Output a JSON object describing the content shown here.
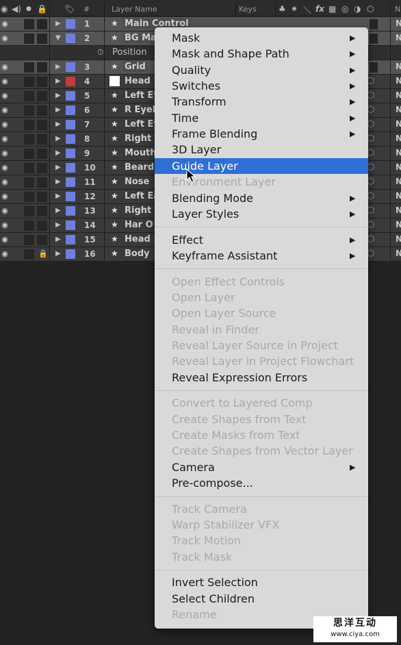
{
  "timeline": {
    "header": {
      "hash": "#",
      "layer_name": "Layer Name",
      "keys": "Keys",
      "fx": "fx",
      "mode_col": "N"
    },
    "layers": [
      {
        "num": "1",
        "name": "Main Control",
        "color": "#6f7fe0",
        "expanded": false,
        "selected": true,
        "boxed": true
      },
      {
        "num": "2",
        "name": "BG Ma",
        "color": "#6f7fe0",
        "expanded": true,
        "selected": true,
        "boxed": true
      },
      {
        "property": "Position"
      },
      {
        "num": "3",
        "name": "Grid",
        "color": "#6f7fe0",
        "expanded": false,
        "selected": true,
        "boxed": true
      },
      {
        "num": "4",
        "name": "Head",
        "color": "#c83a3a",
        "swatch": true
      },
      {
        "num": "5",
        "name": "Left Ey",
        "color": "#6f7fe0"
      },
      {
        "num": "6",
        "name": "R Eyeb",
        "color": "#6f7fe0"
      },
      {
        "num": "7",
        "name": "Left Ey",
        "color": "#6f7fe0"
      },
      {
        "num": "8",
        "name": "Right",
        "color": "#6f7fe0"
      },
      {
        "num": "9",
        "name": "Mouth",
        "color": "#6f7fe0"
      },
      {
        "num": "10",
        "name": "Beard",
        "color": "#6f7fe0"
      },
      {
        "num": "11",
        "name": "Nose",
        "color": "#6f7fe0"
      },
      {
        "num": "12",
        "name": "Left Ea",
        "color": "#6f7fe0"
      },
      {
        "num": "13",
        "name": "Right",
        "color": "#6f7fe0"
      },
      {
        "num": "14",
        "name": "Har O",
        "color": "#6f7fe0"
      },
      {
        "num": "15",
        "name": "Head",
        "color": "#6f7fe0"
      },
      {
        "num": "16",
        "name": "Body",
        "color": "#6f7fe0",
        "locked": true
      }
    ]
  },
  "context_menu": {
    "highlight_color": "#2f6fd6",
    "items": [
      {
        "label": "Mask",
        "submenu": true
      },
      {
        "label": "Mask and Shape Path",
        "submenu": true
      },
      {
        "label": "Quality",
        "submenu": true
      },
      {
        "label": "Switches",
        "submenu": true
      },
      {
        "label": "Transform",
        "submenu": true
      },
      {
        "label": "Time",
        "submenu": true
      },
      {
        "label": "Frame Blending",
        "submenu": true
      },
      {
        "label": "3D Layer"
      },
      {
        "label": "Guide Layer",
        "highlighted": true
      },
      {
        "label": "Environment Layer",
        "disabled": true
      },
      {
        "label": "Blending Mode",
        "submenu": true
      },
      {
        "label": "Layer Styles",
        "submenu": true
      },
      {
        "separator": true
      },
      {
        "label": "Effect",
        "submenu": true
      },
      {
        "label": "Keyframe Assistant",
        "submenu": true
      },
      {
        "separator": true
      },
      {
        "label": "Open Effect Controls",
        "disabled": true
      },
      {
        "label": "Open Layer",
        "disabled": true
      },
      {
        "label": "Open Layer Source",
        "disabled": true
      },
      {
        "label": "Reveal in Finder",
        "disabled": true
      },
      {
        "label": "Reveal Layer Source in Project",
        "disabled": true
      },
      {
        "label": "Reveal Layer in Project Flowchart",
        "disabled": true
      },
      {
        "label": "Reveal Expression Errors"
      },
      {
        "separator": true
      },
      {
        "label": "Convert to Layered Comp",
        "disabled": true
      },
      {
        "label": "Create Shapes from Text",
        "disabled": true
      },
      {
        "label": "Create Masks from Text",
        "disabled": true
      },
      {
        "label": "Create Shapes from Vector Layer",
        "disabled": true
      },
      {
        "label": "Camera",
        "submenu": true
      },
      {
        "label": "Pre-compose..."
      },
      {
        "separator": true
      },
      {
        "label": "Track Camera",
        "disabled": true
      },
      {
        "label": "Warp Stabilizer VFX",
        "disabled": true
      },
      {
        "label": "Track Motion",
        "disabled": true
      },
      {
        "label": "Track Mask",
        "disabled": true
      },
      {
        "separator": true
      },
      {
        "label": "Invert Selection"
      },
      {
        "label": "Select Children"
      },
      {
        "label": "Rename",
        "disabled": true
      }
    ]
  },
  "watermark": {
    "line1": "思洋互动",
    "line2": "www.ciya.com"
  }
}
